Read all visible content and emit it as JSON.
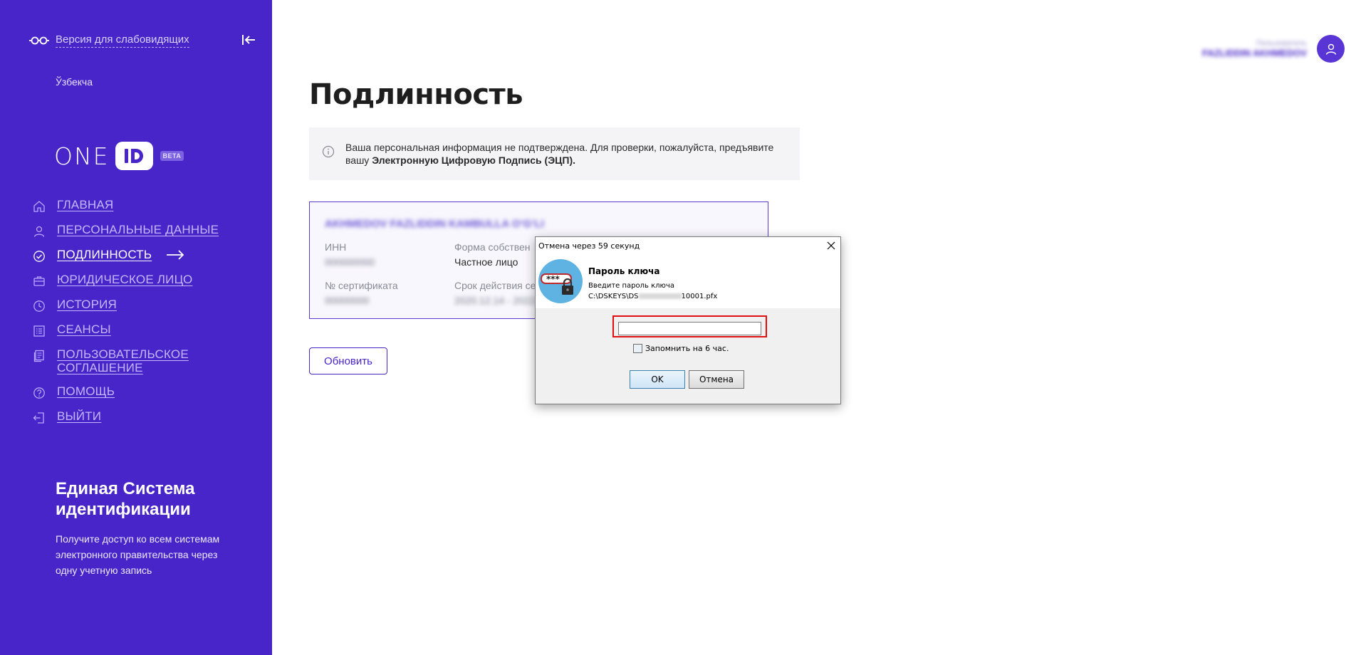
{
  "sidebar": {
    "a11y_label": "Версия для слабовидящих",
    "language": "Ўзбекча",
    "logo": {
      "text": "ONE",
      "badge": "BETA"
    },
    "items": [
      {
        "label": "ГЛАВНАЯ",
        "icon": "home-icon"
      },
      {
        "label": "ПЕРСОНАЛЬНЫЕ ДАННЫЕ",
        "icon": "person-icon"
      },
      {
        "label": "ПОДЛИННОСТЬ",
        "icon": "check-circle-icon",
        "active": true
      },
      {
        "label": "ЮРИДИЧЕСКОЕ ЛИЦО",
        "icon": "briefcase-icon"
      },
      {
        "label": "ИСТОРИЯ",
        "icon": "clock-icon"
      },
      {
        "label": "СЕАНСЫ",
        "icon": "list-icon"
      },
      {
        "label": "ПОЛЬЗОВАТЕЛЬСКОЕ СОГЛАШЕНИЕ",
        "icon": "document-icon"
      },
      {
        "label": "ПОМОЩЬ",
        "icon": "help-icon"
      },
      {
        "label": "ВЫЙТИ",
        "icon": "logout-icon"
      }
    ],
    "promo_title": "Единая Система идентификации",
    "promo_text": "Получите доступ ко всем системам электронного правительства через одну учетную запись"
  },
  "header": {
    "user_role": "Пользователь",
    "user_name": "FAZLIDDIN AKHMEDOV"
  },
  "main": {
    "title": "Подлинность",
    "notice_text": "Ваша персональная информация не подтверждена. Для проверки, пожалуйста, предъявите вашу ",
    "notice_bold": "Электронную Цифровую Подпись (ЭЦП).",
    "certificate": {
      "owner": "AKHMEDOV FAZLIDDIN KAMBULLA OʻGʻLI",
      "inn_label": "ИНН",
      "inn_value": "000000000",
      "ownership_label": "Форма собствен",
      "ownership_value": "Частное лицо",
      "cert_no_label": "№ сертификата",
      "cert_no_value": "00000000",
      "validity_label": "Срок действия се",
      "validity_value": "2020.12.14 - 2022.12.14"
    },
    "refresh_label": "Обновить"
  },
  "dialog": {
    "title": "Отмена через 59 секунд",
    "heading": "Пароль ключа",
    "subtitle": "Введите пароль ключа",
    "path_prefix": "C:\\DSKEYS\\DS",
    "path_suffix": "10001.pfx",
    "password_value": "",
    "remember_label": "Запомнить на 6 час.",
    "ok_label": "OK",
    "cancel_label": "Отмена"
  },
  "colors": {
    "sidebar_bg": "#4825c9",
    "accent": "#4825c9",
    "highlight_red": "#e01010"
  }
}
